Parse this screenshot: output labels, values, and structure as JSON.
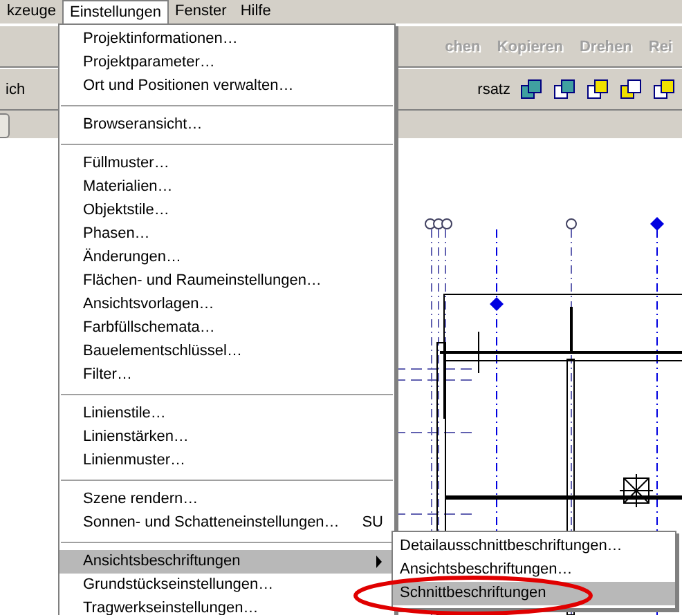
{
  "menubar": [
    {
      "label": "kzeuge",
      "selected": false
    },
    {
      "label": "Einstellungen",
      "selected": true
    },
    {
      "label": "Fenster",
      "selected": false
    },
    {
      "label": "Hilfe",
      "selected": false
    }
  ],
  "toolbar_1": {
    "buttons": [
      {
        "label": "chen",
        "disabled": true
      },
      {
        "label": "Kopieren",
        "disabled": true
      },
      {
        "label": "Drehen",
        "disabled": true
      },
      {
        "label": "Rei",
        "disabled": true
      }
    ]
  },
  "toolbar_2": {
    "left_label": "ich",
    "right_label": "rsatz"
  },
  "menu": {
    "items": [
      {
        "kind": "item",
        "label": "Projektinformationen…"
      },
      {
        "kind": "item",
        "label": "Projektparameter…"
      },
      {
        "kind": "item",
        "label": "Ort und Positionen verwalten…"
      },
      {
        "kind": "separator"
      },
      {
        "kind": "item",
        "label": "Browseransicht…"
      },
      {
        "kind": "separator"
      },
      {
        "kind": "item",
        "label": "Füllmuster…"
      },
      {
        "kind": "item",
        "label": "Materialien…"
      },
      {
        "kind": "item",
        "label": "Objektstile…"
      },
      {
        "kind": "item",
        "label": "Phasen…"
      },
      {
        "kind": "item",
        "label": "Änderungen…"
      },
      {
        "kind": "item",
        "label": "Flächen- und Raumeinstellungen…"
      },
      {
        "kind": "item",
        "label": "Ansichtsvorlagen…"
      },
      {
        "kind": "item",
        "label": "Farbfüllschemata…"
      },
      {
        "kind": "item",
        "label": "Bauelementschlüssel…"
      },
      {
        "kind": "item",
        "label": "Filter…"
      },
      {
        "kind": "separator"
      },
      {
        "kind": "item",
        "label": "Linienstile…"
      },
      {
        "kind": "item",
        "label": "Linienstärken…"
      },
      {
        "kind": "item",
        "label": "Linienmuster…"
      },
      {
        "kind": "separator"
      },
      {
        "kind": "item",
        "label": "Szene rendern…"
      },
      {
        "kind": "item",
        "label": "Sonnen- und Schatteneinstellungen…",
        "shortcut": "SU"
      },
      {
        "kind": "separator"
      },
      {
        "kind": "submenu",
        "label": "Ansichtsbeschriftungen",
        "selected": true
      },
      {
        "kind": "item",
        "label": "Grundstückseinstellungen…"
      },
      {
        "kind": "item",
        "label": "Tragwerkseinstellungen…"
      }
    ]
  },
  "submenu": {
    "items": [
      {
        "label": "Detailausschnittbeschriftungen…",
        "selected": false
      },
      {
        "label": "Ansichtsbeschriftungen…",
        "selected": false
      },
      {
        "label": "Schnittbeschriftungen",
        "selected": true
      }
    ]
  }
}
